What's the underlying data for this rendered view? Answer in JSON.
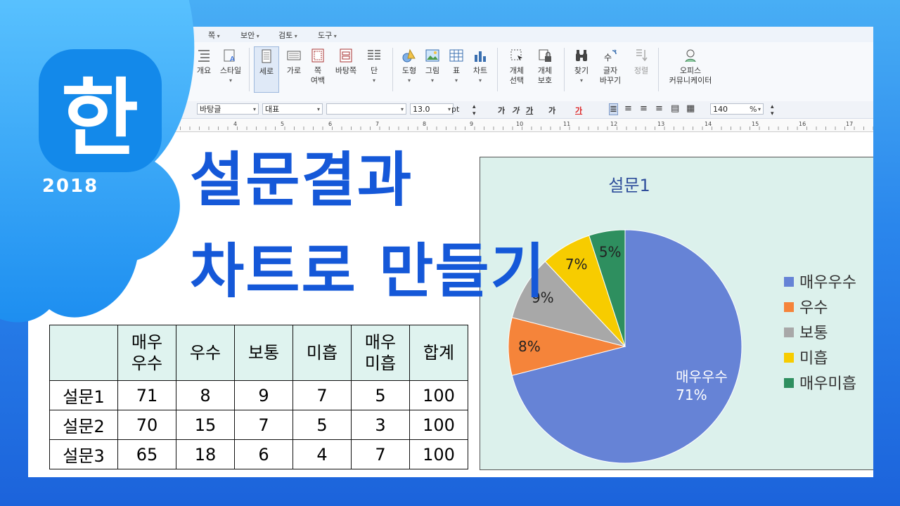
{
  "menu": [
    "쪽",
    "보안",
    "검토",
    "도구"
  ],
  "ribbon": {
    "partial_left": [
      "개요",
      "스타일"
    ],
    "items": [
      {
        "label": "세로",
        "icon": "portrait-page-icon",
        "selected": true
      },
      {
        "label": "가로",
        "icon": "landscape-page-icon"
      },
      {
        "label": "쪽\n여백",
        "icon": "page-margin-icon"
      },
      {
        "label": "바탕쪽",
        "icon": "master-page-icon"
      },
      {
        "label": "단",
        "icon": "columns-icon"
      },
      {
        "label": "도형",
        "icon": "shape-icon"
      },
      {
        "label": "그림",
        "icon": "picture-icon"
      },
      {
        "label": "표",
        "icon": "table-icon"
      },
      {
        "label": "차트",
        "icon": "chart-icon"
      },
      {
        "label": "개체\n선택",
        "icon": "object-select-icon"
      },
      {
        "label": "개체\n보호",
        "icon": "object-protect-icon"
      },
      {
        "label": "찾기",
        "icon": "binoculars-icon"
      },
      {
        "label": "글자\n바꾸기",
        "icon": "replace-icon"
      },
      {
        "label": "정렬",
        "icon": "sort-icon"
      },
      {
        "label": "오피스\n커뮤니케이터",
        "icon": "communicator-icon"
      }
    ]
  },
  "format": {
    "style_combo": "바탕글",
    "font_name": "대표",
    "font_face": "",
    "font_size": "13.0",
    "size_unit": "pt",
    "zoom": "140",
    "zoom_unit": "%"
  },
  "ruler_ticks": [
    "4",
    "5",
    "6",
    "7",
    "8",
    "9",
    "10",
    "11",
    "12",
    "13",
    "14",
    "15",
    "16",
    "17"
  ],
  "logo": {
    "glyph": "한",
    "year": "2018"
  },
  "title_line1": "설문결과",
  "title_line2": "차트로 만들기",
  "table": {
    "headers": [
      "",
      "매우\n우수",
      "우수",
      "보통",
      "미흡",
      "매우\n미흡",
      "합계"
    ],
    "rows": [
      [
        "설문1",
        "71",
        "8",
        "9",
        "7",
        "5",
        "100"
      ],
      [
        "설문2",
        "70",
        "15",
        "7",
        "5",
        "3",
        "100"
      ],
      [
        "설문3",
        "65",
        "18",
        "6",
        "4",
        "7",
        "100"
      ]
    ]
  },
  "chart_data": {
    "type": "pie",
    "title": "설문1",
    "categories": [
      "매우우수",
      "우수",
      "보통",
      "미흡",
      "매우미흡"
    ],
    "values": [
      71,
      8,
      9,
      7,
      5
    ],
    "labels": [
      "매우우수\n71%",
      "8%",
      "9%",
      "7%",
      "5%"
    ],
    "colors": [
      "#6683d6",
      "#f5843a",
      "#a8a8a8",
      "#f7cc00",
      "#2e8f5f"
    ],
    "legend": "right",
    "background": "#dcf1ec"
  },
  "colors": {
    "accent": "#1558d8",
    "frame": "#1f6fe0"
  }
}
